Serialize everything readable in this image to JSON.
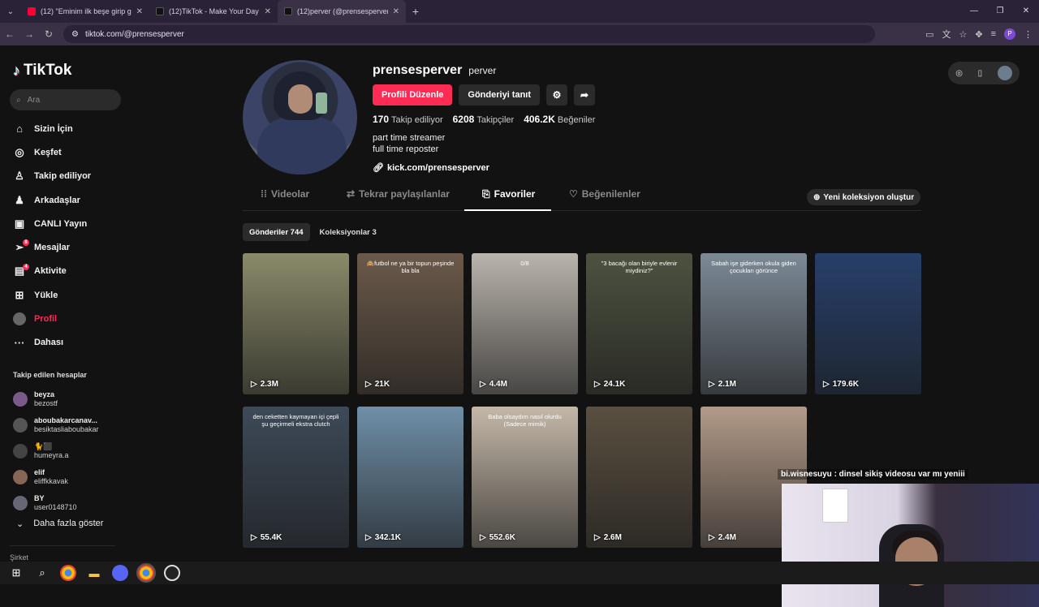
{
  "browser": {
    "tabs": [
      {
        "label": "(12) \"Eminim ilk beşe girip grup",
        "color": "#ff0033"
      },
      {
        "label": "(12)TikTok - Make Your Day",
        "color": "#111111"
      },
      {
        "label": "(12)perver (@prensesperver) | T",
        "color": "#111111"
      }
    ],
    "url": "tiktok.com/@prensesperver",
    "profile_initial": "P"
  },
  "sidebar": {
    "logo": "TikTok",
    "search_placeholder": "Ara",
    "nav": [
      {
        "label": "Sizin İçin",
        "icon": "home-icon",
        "glyph": "⌂"
      },
      {
        "label": "Keşfet",
        "icon": "compass-icon",
        "glyph": "◎"
      },
      {
        "label": "Takip ediliyor",
        "icon": "following-icon",
        "glyph": "👤"
      },
      {
        "label": "Arkadaşlar",
        "icon": "friends-icon",
        "glyph": "👥"
      },
      {
        "label": "CANLI Yayın",
        "icon": "live-icon",
        "glyph": "▣"
      },
      {
        "label": "Mesajlar",
        "icon": "messages-icon",
        "glyph": "✈",
        "badge": "8"
      },
      {
        "label": "Aktivite",
        "icon": "activity-icon",
        "glyph": "▤",
        "badge": "4"
      },
      {
        "label": "Yükle",
        "icon": "upload-icon",
        "glyph": "⊞"
      },
      {
        "label": "Profil",
        "icon": "profile-icon",
        "glyph": "●"
      },
      {
        "label": "Dahası",
        "icon": "more-icon",
        "glyph": "···"
      }
    ],
    "following_title": "Takip edilen hesaplar",
    "following": [
      {
        "name": "beyza",
        "handle": "bezostf",
        "color": "#7a5a8a"
      },
      {
        "name": "aboubakarcanav...",
        "handle": "besiktasliaboubakar",
        "color": "#555555"
      },
      {
        "name": "🐈⬛",
        "handle": "humeyra.a",
        "color": "#444444"
      },
      {
        "name": "elif",
        "handle": "eliffkkavak",
        "color": "#886655"
      },
      {
        "name": "BY",
        "handle": "user0148710",
        "color": "#666677"
      }
    ],
    "show_more": "Daha fazla göster",
    "company": "Şirket"
  },
  "profile": {
    "username": "prensesperver",
    "nickname": "perver",
    "edit_button": "Profili Düzenle",
    "promote_button": "Gönderiyi tanıt",
    "following_count": "170",
    "following_label": "Takip ediliyor",
    "followers_count": "6208",
    "followers_label": "Takipçiler",
    "likes_count": "406.2K",
    "likes_label": "Beğeniler",
    "bio_line1": "part time streamer",
    "bio_line2": "full time reposter",
    "link": "kick.com/prensesperver"
  },
  "tabs": {
    "videos": "Videolar",
    "reposts": "Tekrar paylaşılanlar",
    "favorites": "Favoriler",
    "liked": "Beğenilenler",
    "new_collection": "Yeni koleksiyon oluştur",
    "posts_sub": "Gönderiler 744",
    "collections_sub": "Koleksiyonlar 3"
  },
  "videos": [
    {
      "views": "2.3M",
      "caption": "",
      "bg": "#8a8a6a"
    },
    {
      "views": "21K",
      "caption": "🙈futbol ne ya bir topun peşinde bla bla",
      "bg": "#6b5a4a"
    },
    {
      "views": "4.4M",
      "caption": "0/8",
      "bg": "#b9b4ac"
    },
    {
      "views": "24.1K",
      "caption": "\"3 bacağı olan biriyle evlenir miydiniz?\"",
      "bg": "#4d5240"
    },
    {
      "views": "2.1M",
      "caption": "Sabah işe giderken okula giden çocukları görünce",
      "bg": "#7c8a96"
    },
    {
      "views": "179.6K",
      "caption": "",
      "bg": "#27406a"
    },
    {
      "views": "55.4K",
      "caption": "den ceketten kaymayan içi çepli şu geçirmeli ekstra clutch",
      "bg": "#3d4a58"
    },
    {
      "views": "342.1K",
      "caption": "",
      "bg": "#6f8fa8"
    },
    {
      "views": "552.6K",
      "caption": "Baba olsaydım nasıl olurdu (Sadece mimik)",
      "bg": "#c4b8a8"
    },
    {
      "views": "2.6M",
      "caption": "",
      "bg": "#5a5040"
    },
    {
      "views": "2.4M",
      "caption": "",
      "bg": "#b29a88"
    }
  ],
  "stream": {
    "chat": "bi.wisnesuyu : dinsel sikiş videosu var mı yeniii"
  },
  "colors": {
    "accent": "#fe2c55",
    "background": "#121212"
  }
}
